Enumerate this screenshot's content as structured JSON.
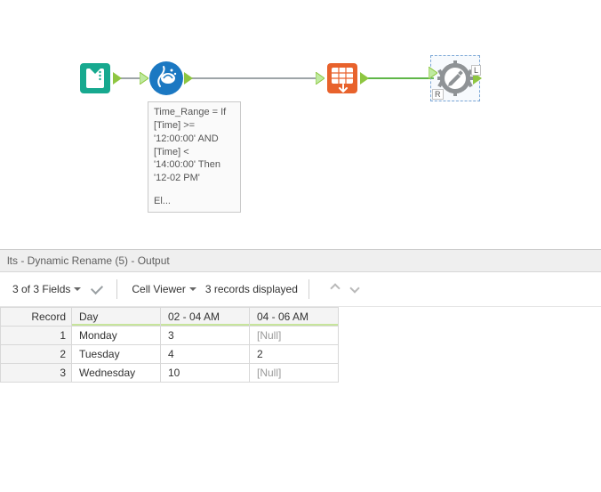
{
  "canvas": {
    "tools": {
      "input": {
        "name": "input-data-tool"
      },
      "formula": {
        "name": "formula-tool"
      },
      "crosstab": {
        "name": "crosstab-tool"
      },
      "dynamicrename": {
        "name": "dynamic-rename-tool"
      }
    },
    "annotation": {
      "line1": "Time_Range = If",
      "line2": "[Time] >=",
      "line3": "'12:00:00' AND",
      "line4": "[Time] <",
      "line5": "'14:00:00' Then",
      "line6": "'12-02 PM'",
      "line7": "",
      "line8": "El..."
    },
    "selected_labels": {
      "top_right": "L",
      "bottom_left": "R"
    }
  },
  "results": {
    "panel_title": "lts - Dynamic Rename (5) - Output",
    "fields_summary": "3 of 3 Fields",
    "cell_viewer_label": "Cell Viewer",
    "records_text": "3 records displayed",
    "columns": {
      "record": "Record",
      "day": "Day",
      "c1": "02 - 04 AM",
      "c2": "04 - 06 AM"
    },
    "rows": [
      {
        "rec": "1",
        "day": "Monday",
        "c1": "3",
        "c2": "[Null]",
        "c2_null": true
      },
      {
        "rec": "2",
        "day": "Tuesday",
        "c1": "4",
        "c2": "2",
        "c2_null": false
      },
      {
        "rec": "3",
        "day": "Wednesday",
        "c1": "10",
        "c2": "[Null]",
        "c2_null": true
      }
    ]
  },
  "chart_data": {
    "type": "table",
    "title": "Dynamic Rename (5) - Output",
    "columns": [
      "Record",
      "Day",
      "02 - 04 AM",
      "04 - 06 AM"
    ],
    "rows": [
      [
        1,
        "Monday",
        3,
        null
      ],
      [
        2,
        "Tuesday",
        4,
        2
      ],
      [
        3,
        "Wednesday",
        10,
        null
      ]
    ]
  }
}
